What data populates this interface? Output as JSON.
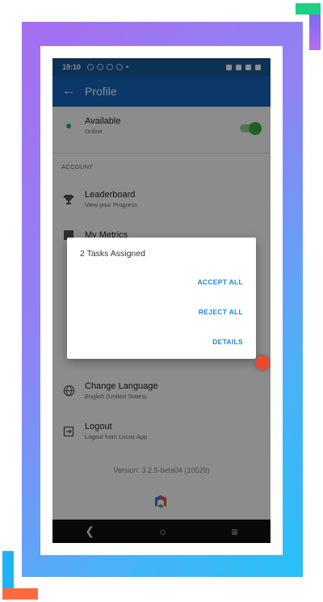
{
  "status_bar": {
    "time": "19:10"
  },
  "app_bar": {
    "title": "Profile"
  },
  "availability": {
    "label": "Available",
    "sublabel": "Online",
    "toggle_on": true
  },
  "account_section": {
    "header": "ACCOUNT",
    "items": [
      {
        "label": "Leaderboard",
        "sublabel": "View your Progress",
        "icon": "trophy-icon"
      },
      {
        "label": "My Metrics",
        "sublabel": "",
        "icon": "metrics-icon"
      }
    ]
  },
  "more_items": [
    {
      "label": "Change Language",
      "sublabel": "English (United States)",
      "icon": "globe-icon"
    },
    {
      "label": "Logout",
      "sublabel": "Logout from Locus App",
      "icon": "logout-icon"
    }
  ],
  "version": "Version: 3.2.5-beta04 (10529)",
  "dialog": {
    "title": "2 Tasks Assigned",
    "accept_all": "ACCEPT ALL",
    "reject_all": "REJECT ALL",
    "details": "DETAILS"
  },
  "colors": {
    "app_bar": "#1565c0",
    "status_bar": "#195999",
    "dialog_action": "#1a87d6",
    "toggle": "#3cb043"
  }
}
